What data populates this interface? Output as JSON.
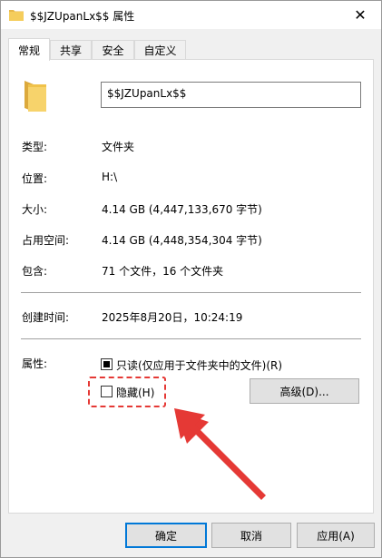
{
  "window": {
    "title": "$$JZUpanLx$$ 属性",
    "close": "✕"
  },
  "tabs": [
    {
      "label": "常规",
      "active": true
    },
    {
      "label": "共享",
      "active": false
    },
    {
      "label": "安全",
      "active": false
    },
    {
      "label": "自定义",
      "active": false
    }
  ],
  "general": {
    "name_value": "$$JZUpanLx$$",
    "rows": [
      {
        "label": "类型:",
        "value": "文件夹"
      },
      {
        "label": "位置:",
        "value": "H:\\"
      },
      {
        "label": "大小:",
        "value": "4.14 GB (4,447,133,670 字节)"
      },
      {
        "label": "占用空间:",
        "value": "4.14 GB (4,448,354,304 字节)"
      },
      {
        "label": "包含:",
        "value": "71 个文件，16 个文件夹"
      },
      {
        "label": "创建时间:",
        "value": "2025年8月20日，10:24:19"
      }
    ],
    "attributes_label": "属性:",
    "readonly_label": "只读(仅应用于文件夹中的文件)(R)",
    "hidden_label": "隐藏(H)",
    "advanced_button": "高级(D)..."
  },
  "footer": {
    "ok": "确定",
    "cancel": "取消",
    "apply": "应用(A)"
  },
  "icons": {
    "folder": "folder-icon",
    "close": "close-icon"
  },
  "colors": {
    "folder": "#f2c94c",
    "highlight": "#e53935",
    "default_button_border": "#0078d7"
  }
}
